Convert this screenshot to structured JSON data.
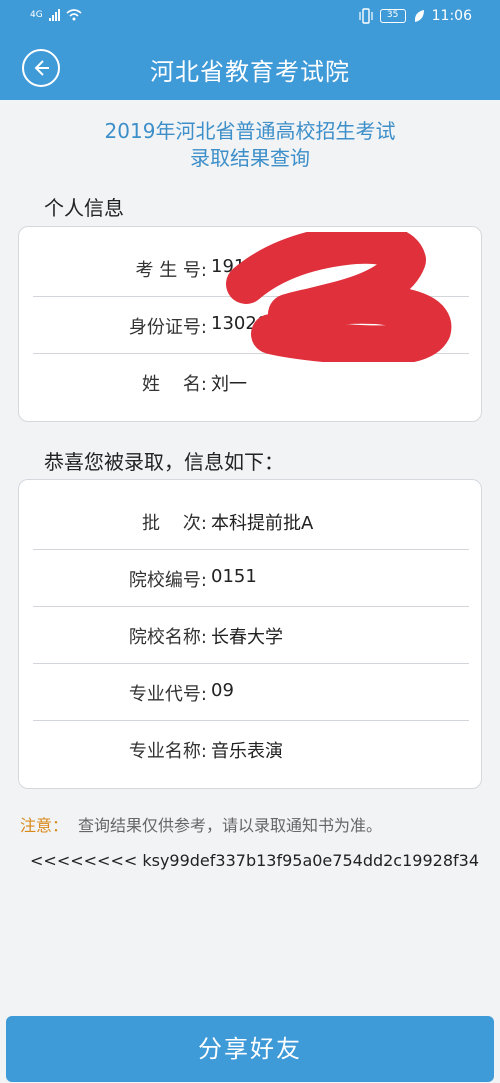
{
  "status_bar": {
    "network": "4G",
    "battery": "35",
    "time": "11:06"
  },
  "header": {
    "title": "河北省教育考试院"
  },
  "page": {
    "title_line1": "2019年河北省普通高校招生考试",
    "title_line2": "录取结果查询"
  },
  "personal": {
    "section_title": "个人信息",
    "rows": [
      {
        "label": "考 生 号:",
        "value": "19130"
      },
      {
        "label": "身份证号:",
        "value": "130203"
      },
      {
        "label": "姓    名:",
        "value": "刘一"
      }
    ]
  },
  "admission": {
    "section_title": "恭喜您被录取，信息如下：",
    "rows": [
      {
        "label": "批    次:",
        "value": "本科提前批A"
      },
      {
        "label": "院校编号:",
        "value": "0151"
      },
      {
        "label": "院校名称:",
        "value": "长春大学"
      },
      {
        "label": "专业代号:",
        "value": "09"
      },
      {
        "label": "专业名称:",
        "value": "音乐表演"
      }
    ]
  },
  "note": {
    "label": "注意：",
    "text": "查询结果仅供参考，请以录取通知书为准。"
  },
  "hash": "<<<<<<<< ksy99def337b13f95a0e754dd2c19928f34",
  "share_button": "分享好友",
  "colors": {
    "primary": "#3f9ad8",
    "title_blue": "#3c8fc9",
    "note_orange": "#d98a1a",
    "redaction": "#e0303c"
  }
}
